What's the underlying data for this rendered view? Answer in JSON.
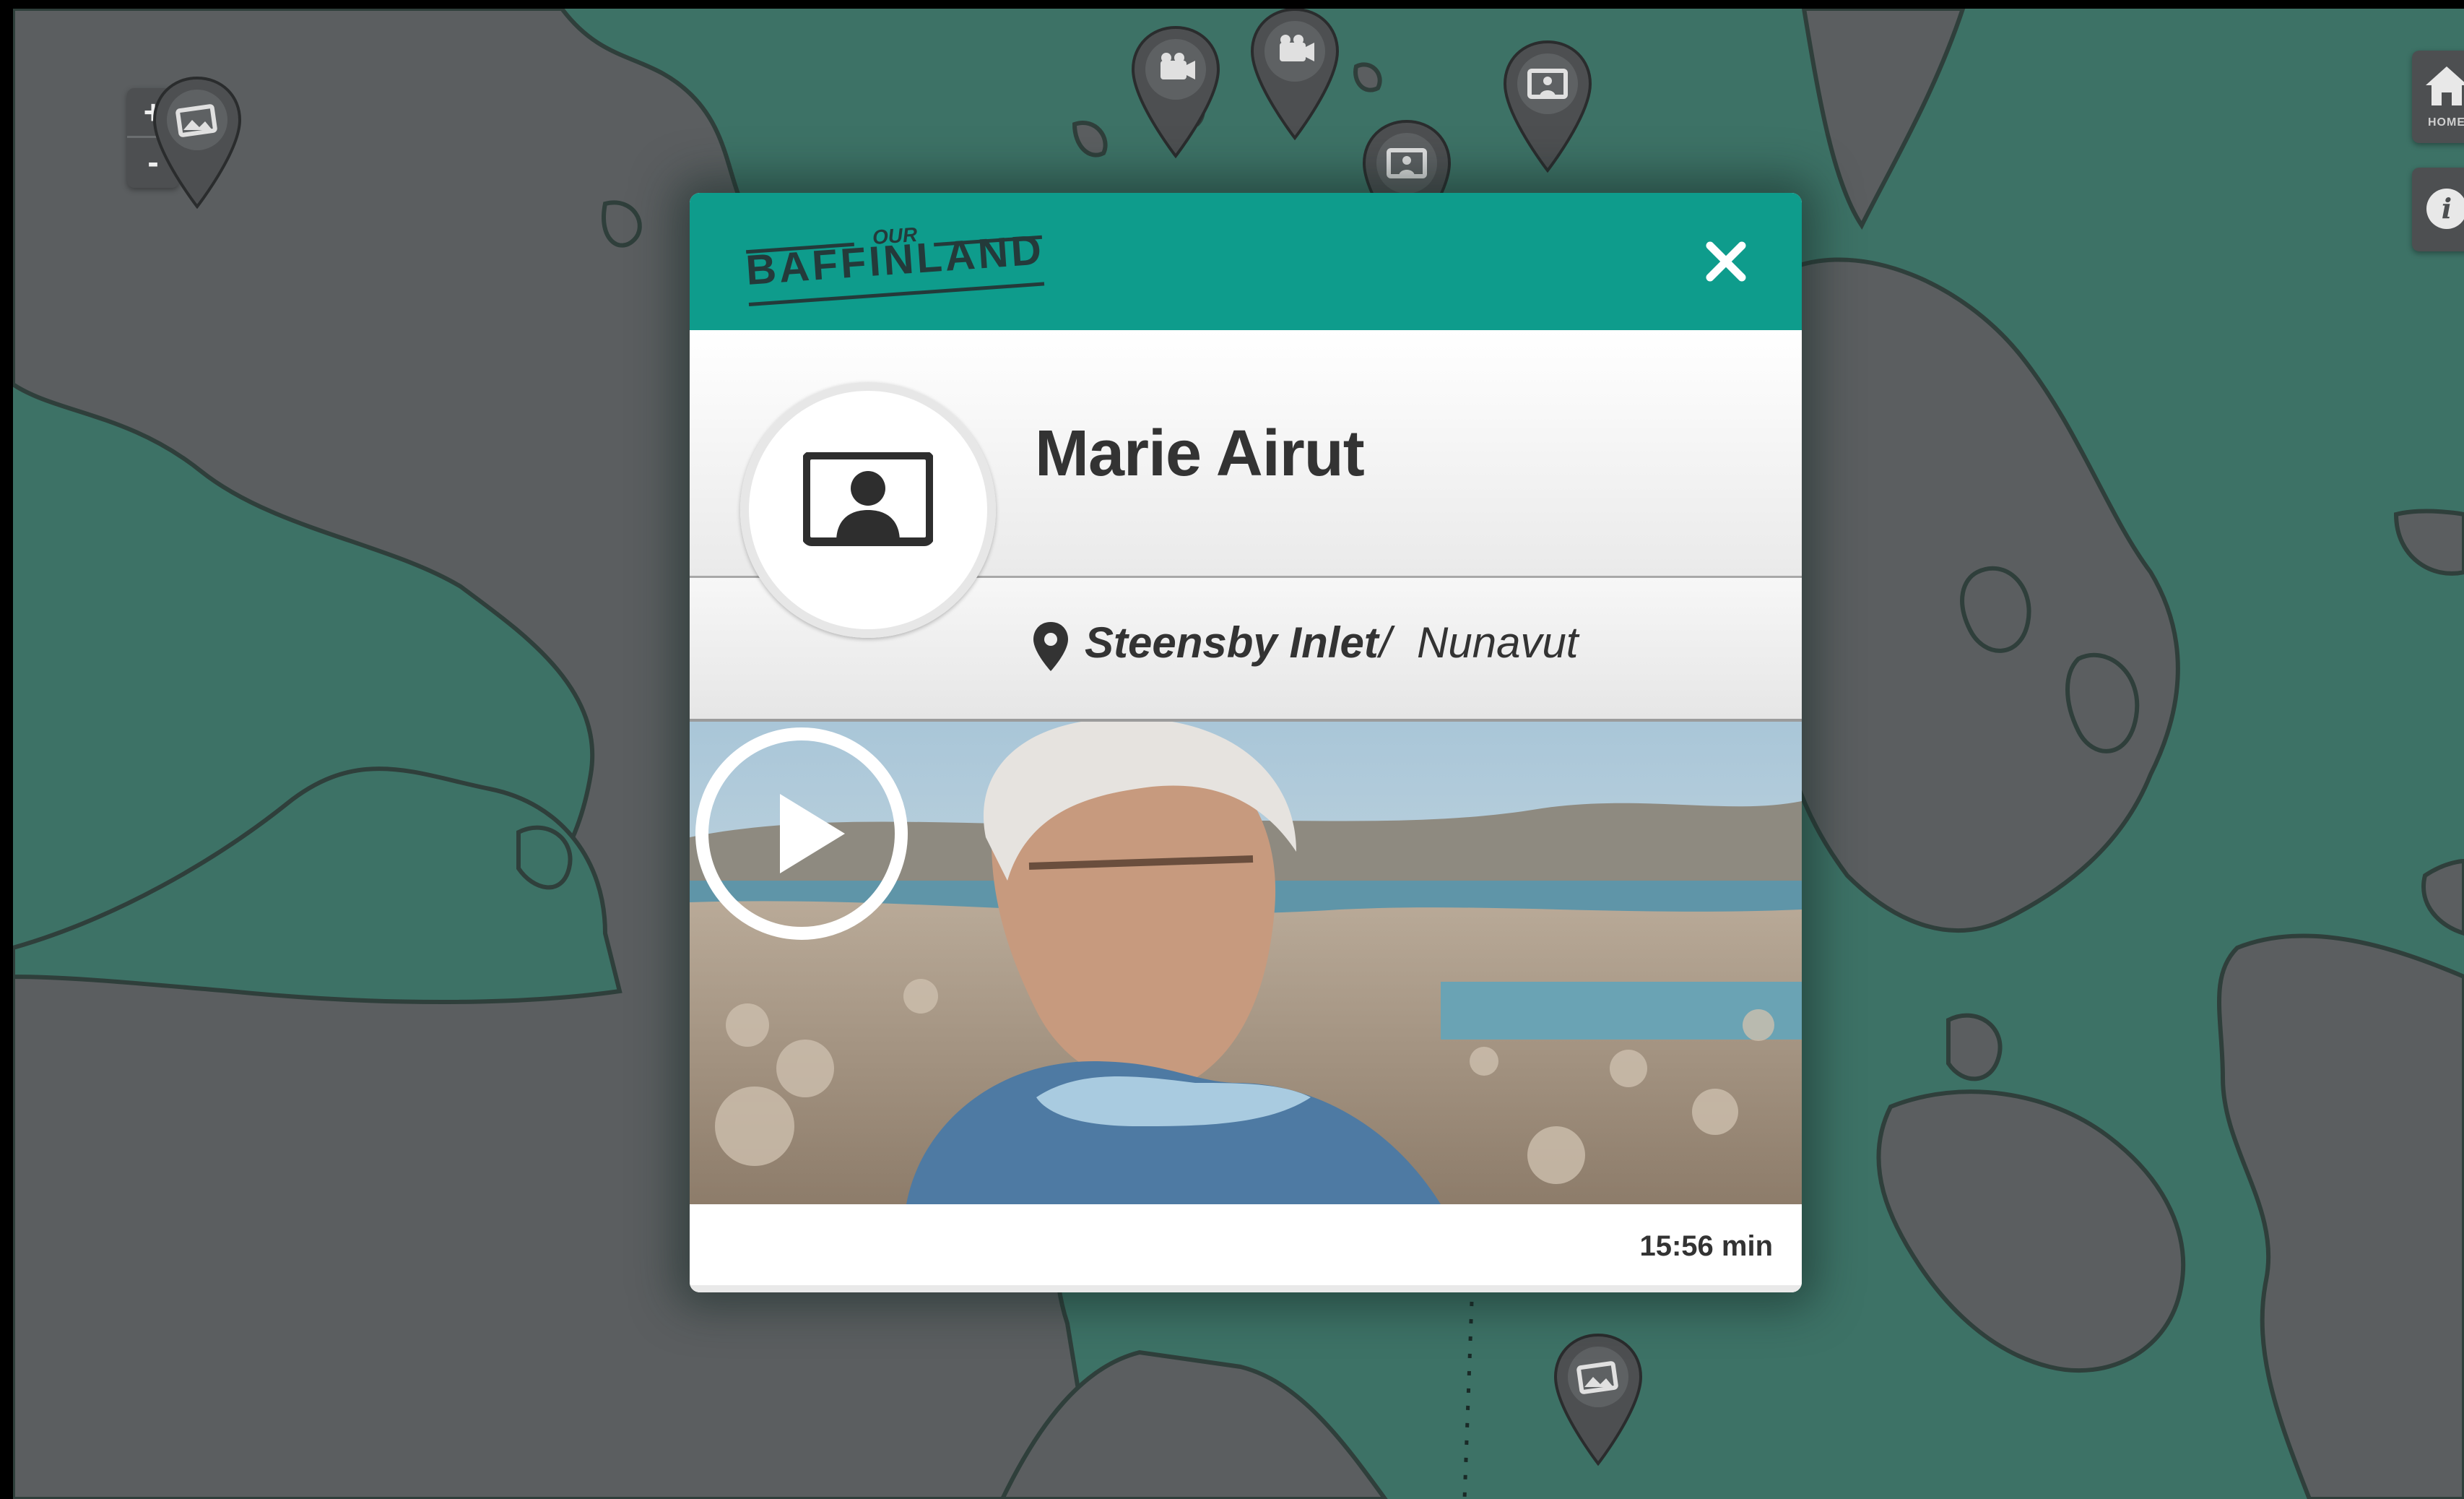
{
  "map": {
    "zoom_in_label": "+",
    "zoom_out_label": "-",
    "home_label": "HOME",
    "info_label": "i",
    "pins": [
      {
        "kind": "photo-icon"
      },
      {
        "kind": "camera-icon"
      },
      {
        "kind": "camera-icon"
      },
      {
        "kind": "portrait-icon"
      },
      {
        "kind": "portrait-icon"
      },
      {
        "kind": "photo-icon"
      }
    ],
    "colors": {
      "water": "#3d7266",
      "land": "#5a5d5f",
      "pin": "#4d4f51"
    }
  },
  "modal": {
    "brand_small": "OUR",
    "brand_main": "BAFFINLAND",
    "close_icon": "close-icon",
    "name": "Marie Airut",
    "location_place": "Steensby Inlet",
    "location_separator": "/",
    "location_region": "Nunavut",
    "duration": "15:56 min",
    "media_type_icon": "portrait-icon",
    "colors": {
      "header": "#0e9c8c",
      "text": "#333333"
    }
  }
}
